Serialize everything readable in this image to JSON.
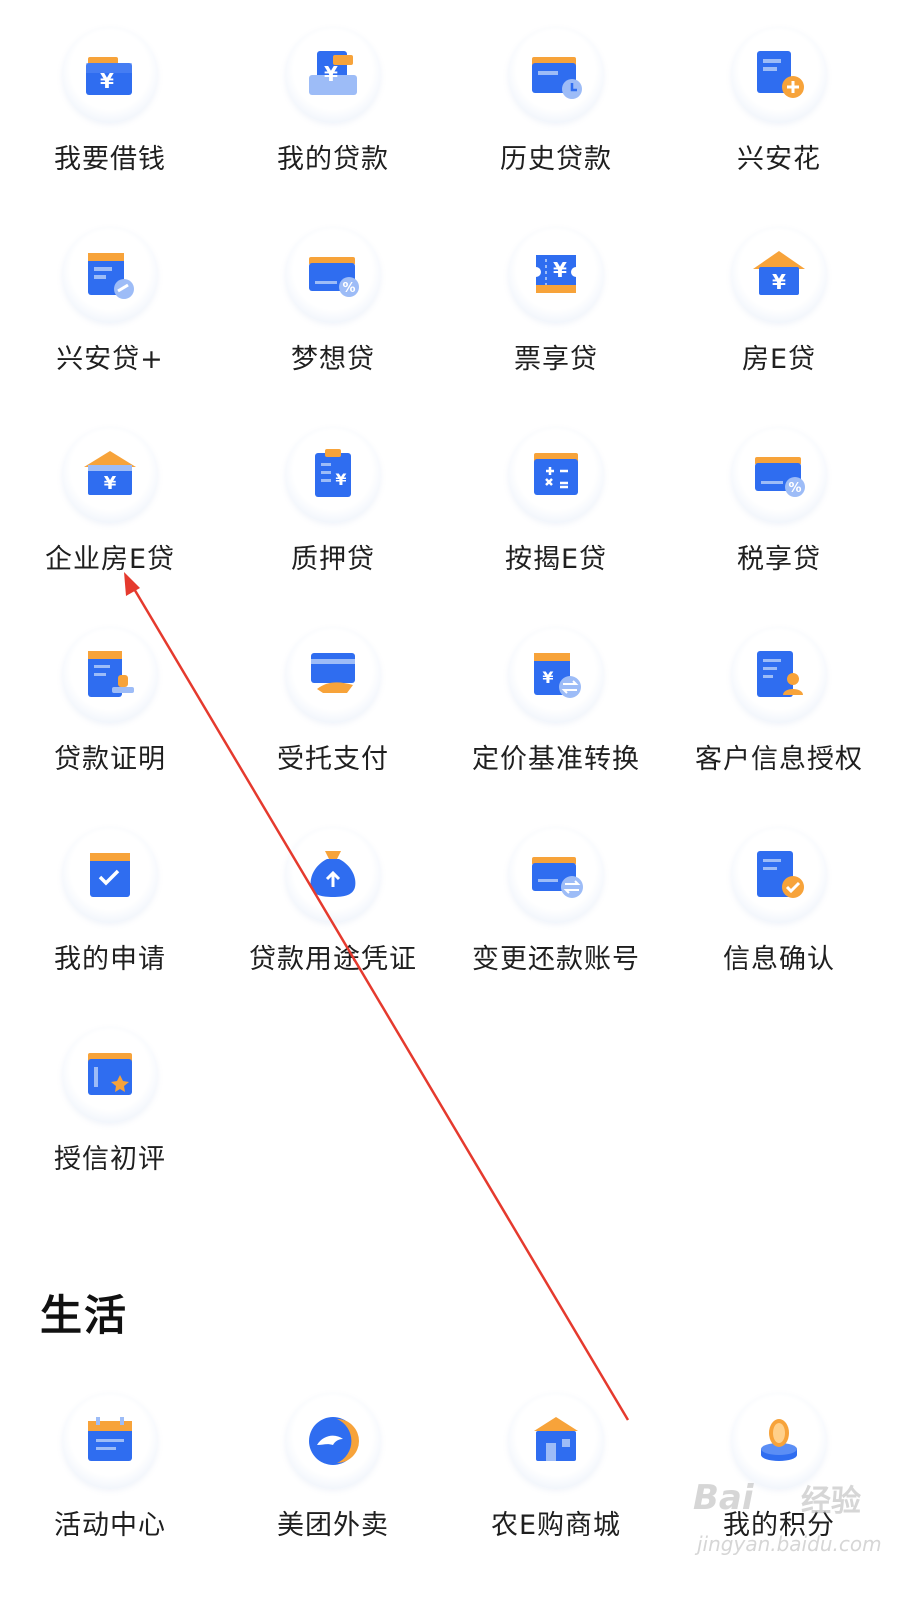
{
  "loan_grid": {
    "items": [
      {
        "label": "我要借钱",
        "icon": "yuan-folder-icon"
      },
      {
        "label": "我的贷款",
        "icon": "yuan-document-icon"
      },
      {
        "label": "历史贷款",
        "icon": "clock-folder-icon"
      },
      {
        "label": "兴安花",
        "icon": "document-plus-icon"
      },
      {
        "label": "兴安贷+",
        "icon": "document-pen-icon"
      },
      {
        "label": "梦想贷",
        "icon": "percent-card-icon"
      },
      {
        "label": "票享贷",
        "icon": "yuan-ticket-icon"
      },
      {
        "label": "房E贷",
        "icon": "yuan-house-icon"
      },
      {
        "label": "企业房E贷",
        "icon": "enterprise-house-icon"
      },
      {
        "label": "质押贷",
        "icon": "yuan-clipboard-icon"
      },
      {
        "label": "按揭E贷",
        "icon": "calculator-folder-icon"
      },
      {
        "label": "税享贷",
        "icon": "percent-card-icon"
      },
      {
        "label": "贷款证明",
        "icon": "stamp-document-icon"
      },
      {
        "label": "受托支付",
        "icon": "hand-card-icon"
      },
      {
        "label": "定价基准转换",
        "icon": "exchange-document-icon"
      },
      {
        "label": "客户信息授权",
        "icon": "user-document-icon"
      },
      {
        "label": "我的申请",
        "icon": "checklist-icon"
      },
      {
        "label": "贷款用途凭证",
        "icon": "money-bag-icon"
      },
      {
        "label": "变更还款账号",
        "icon": "exchange-card-icon"
      },
      {
        "label": "信息确认",
        "icon": "check-document-icon"
      },
      {
        "label": "授信初评",
        "icon": "star-folder-icon"
      }
    ]
  },
  "life_section": {
    "title": "生活",
    "items": [
      {
        "label": "活动中心",
        "icon": "calendar-icon"
      },
      {
        "label": "美团外卖",
        "icon": "meituan-kangaroo-icon"
      },
      {
        "label": "农E购商城",
        "icon": "shop-icon"
      },
      {
        "label": "我的积分",
        "icon": "coin-stack-icon"
      }
    ]
  },
  "watermark": {
    "main": "Bai",
    "cn": "经验",
    "sub": "jingyan.baidu.com"
  },
  "colors": {
    "primary_blue": "#2f6df0",
    "accent_orange": "#f7a33a",
    "light_blue": "#9dbcf7",
    "annotation_red": "#e53a2e"
  }
}
